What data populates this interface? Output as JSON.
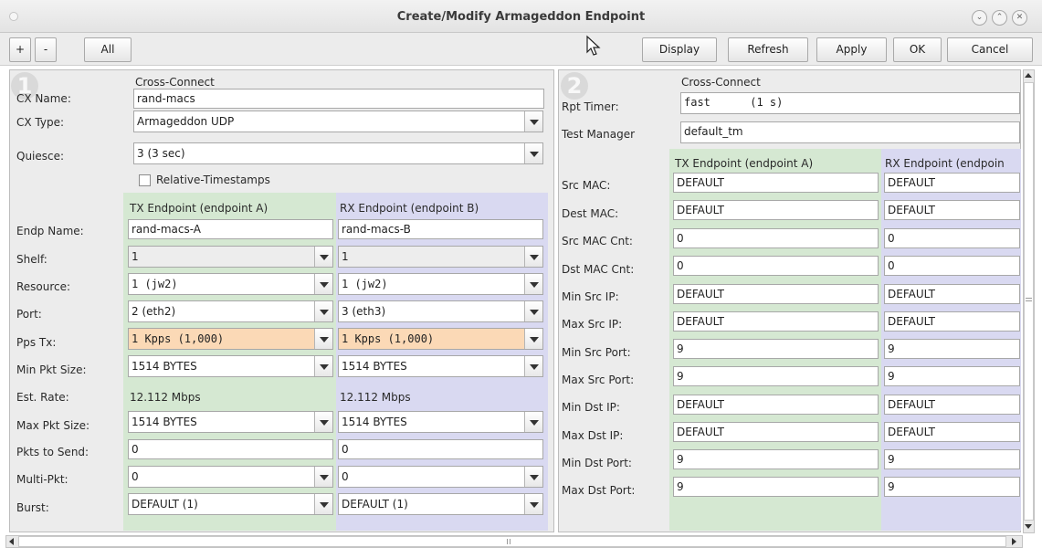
{
  "window": {
    "title": "Create/Modify Armageddon Endpoint",
    "controls": [
      "minimize-icon",
      "maximize-icon",
      "close-icon"
    ]
  },
  "toolbar": {
    "plus": "+",
    "minus": "-",
    "all": "All",
    "display": "Display",
    "refresh": "Refresh",
    "apply": "Apply",
    "ok": "OK",
    "cancel": "Cancel"
  },
  "left": {
    "badge": "1",
    "section_header": "Cross-Connect",
    "cx_name_label": "CX Name:",
    "cx_name": "rand-macs",
    "cx_type_label": "CX Type:",
    "cx_type": "Armageddon UDP",
    "quiesce_label": "Quiesce:",
    "quiesce": "3 (3 sec)",
    "relative_ts": "Relative-Timestamps",
    "tx_header": "TX Endpoint (endpoint A)",
    "rx_header": "RX Endpoint (endpoint B)",
    "labels": {
      "endp_name": "Endp Name:",
      "shelf": "Shelf:",
      "resource": "Resource:",
      "port": "Port:",
      "pps_tx": "Pps Tx:",
      "min_pkt": "Min Pkt Size:",
      "est_rate": "Est. Rate:",
      "max_pkt": "Max Pkt Size:",
      "pkts_send": "Pkts to Send:",
      "multi_pkt": "Multi-Pkt:",
      "burst": "Burst:"
    },
    "tx": {
      "endp_name": "rand-macs-A",
      "shelf": "1",
      "resource": "1 (jw2)",
      "port": "2 (eth2)",
      "pps_tx": "1 Kpps (1,000)",
      "min_pkt": "1514 BYTES",
      "est_rate": "12.112 Mbps",
      "max_pkt": "1514 BYTES",
      "pkts_send": "0",
      "multi_pkt": "0",
      "burst": "DEFAULT (1)"
    },
    "rx": {
      "endp_name": "rand-macs-B",
      "shelf": "1",
      "resource": "1 (jw2)",
      "port": "3 (eth3)",
      "pps_tx": "1 Kpps (1,000)",
      "min_pkt": "1514 BYTES",
      "est_rate": "12.112 Mbps",
      "max_pkt": "1514 BYTES",
      "pkts_send": "0",
      "multi_pkt": "0",
      "burst": "DEFAULT (1)"
    }
  },
  "right": {
    "badge": "2",
    "section_header": "Cross-Connect",
    "rpt_timer_label": "Rpt Timer:",
    "rpt_timer": "fast      (1 s)",
    "test_manager_label": "Test Manager",
    "test_manager": "default_tm",
    "tx_header": "TX Endpoint (endpoint A)",
    "rx_header": "RX Endpoint (endpoin",
    "labels": {
      "src_mac": "Src MAC:",
      "dest_mac": "Dest MAC:",
      "src_mac_cnt": "Src MAC Cnt:",
      "dst_mac_cnt": "Dst MAC Cnt:",
      "min_src_ip": "Min Src IP:",
      "max_src_ip": "Max Src IP:",
      "min_src_port": "Min Src Port:",
      "max_src_port": "Max Src Port:",
      "min_dst_ip": "Min Dst IP:",
      "max_dst_ip": "Max Dst IP:",
      "min_dst_port": "Min Dst Port:",
      "max_dst_port": "Max Dst Port:"
    },
    "tx": {
      "src_mac": "DEFAULT",
      "dest_mac": "DEFAULT",
      "src_mac_cnt": "0",
      "dst_mac_cnt": "0",
      "min_src_ip": "DEFAULT",
      "max_src_ip": "DEFAULT",
      "min_src_port": "9",
      "max_src_port": "9",
      "min_dst_ip": "DEFAULT",
      "max_dst_ip": "DEFAULT",
      "min_dst_port": "9",
      "max_dst_port": "9"
    },
    "rx": {
      "src_mac": "DEFAULT",
      "dest_mac": "DEFAULT",
      "src_mac_cnt": "0",
      "dst_mac_cnt": "0",
      "min_src_ip": "DEFAULT",
      "max_src_ip": "DEFAULT",
      "min_src_port": "9",
      "max_src_port": "9",
      "min_dst_ip": "DEFAULT",
      "max_dst_ip": "DEFAULT",
      "min_dst_port": "9",
      "max_dst_port": "9"
    }
  },
  "colors": {
    "tx_column": "#d5e8d2",
    "rx_column": "#d9d9f1",
    "pps_highlight": "#fbd9b6"
  }
}
